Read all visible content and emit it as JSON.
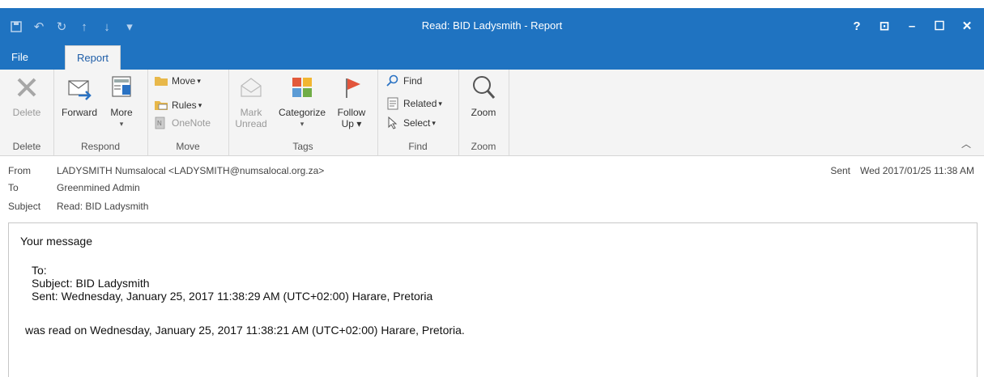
{
  "window": {
    "title": "Read: BID Ladysmith - Report",
    "controls": [
      "?",
      "⊡",
      "–",
      "☐",
      "✕"
    ]
  },
  "quick_access": [
    "save-icon",
    "undo-icon",
    "redo-icon",
    "up-icon",
    "down-icon",
    "customize-icon"
  ],
  "tabs": {
    "file": "File",
    "report": "Report"
  },
  "ribbon": {
    "delete": {
      "button": "Delete",
      "group": "Delete"
    },
    "respond": {
      "forward": "Forward",
      "more": "More",
      "group": "Respond"
    },
    "move": {
      "move": "Move",
      "rules": "Rules",
      "onenote": "OneNote",
      "group": "Move"
    },
    "tags": {
      "mark_unread_1": "Mark",
      "mark_unread_2": "Unread",
      "categorize": "Categorize",
      "follow_1": "Follow",
      "follow_2": "Up",
      "group": "Tags"
    },
    "find": {
      "find": "Find",
      "related": "Related",
      "select": "Select",
      "group": "Find"
    },
    "zoom": {
      "zoom": "Zoom",
      "group": "Zoom"
    }
  },
  "message": {
    "from_label": "From",
    "from": "LADYSMITH Numsalocal <LADYSMITH@numsalocal.org.za>",
    "to_label": "To",
    "to": "Greenmined Admin",
    "subject_label": "Subject",
    "subject": "Read: BID Ladysmith",
    "sent_label": "Sent",
    "sent": "Wed 2017/01/25 11:38 AM"
  },
  "body": {
    "line1": "Your message",
    "to": "To:",
    "subject": "Subject: BID Ladysmith",
    "sent": "Sent: Wednesday, January 25, 2017 11:38:29 AM (UTC+02:00) Harare, Pretoria",
    "read": "was read on Wednesday, January 25, 2017 11:38:21 AM (UTC+02:00) Harare, Pretoria."
  }
}
